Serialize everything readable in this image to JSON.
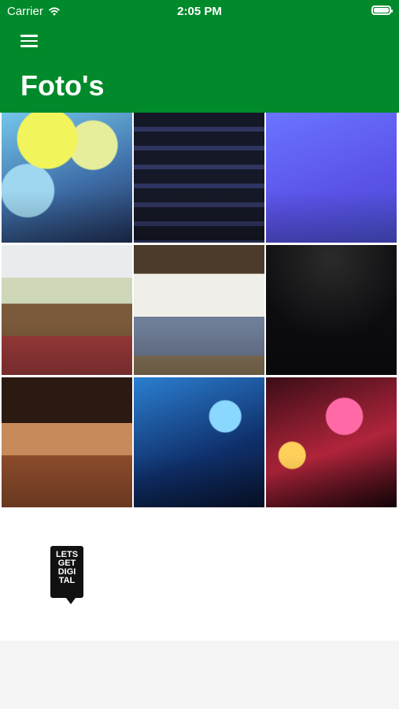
{
  "status_bar": {
    "carrier": "Carrier",
    "time": "2:05 PM"
  },
  "header": {
    "title": "Foto's",
    "color": "#008a2b"
  },
  "icons": {
    "menu": "hamburger-menu-icon",
    "wifi": "wifi-icon",
    "battery": "battery-icon"
  },
  "photos": [
    "photo-1",
    "photo-2",
    "photo-3",
    "photo-4",
    "photo-5",
    "photo-6",
    "photo-7",
    "photo-8",
    "photo-9"
  ],
  "logo": {
    "lines": [
      "LETS",
      "GET",
      "DIGI",
      "TAL"
    ]
  }
}
